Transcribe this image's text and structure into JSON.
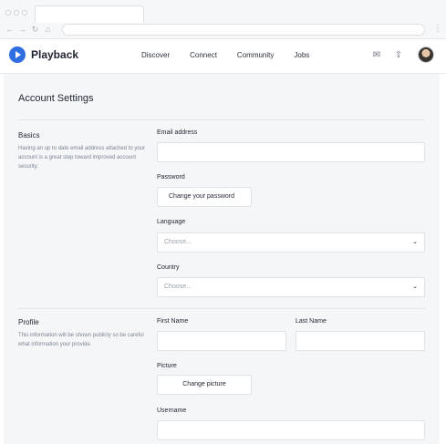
{
  "browser": {
    "nav_icons": {
      "back": "←",
      "forward": "→",
      "reload": "↻",
      "home": "⌂"
    },
    "menu_icon": "⋮"
  },
  "header": {
    "brand": "Playback",
    "nav": [
      "Discover",
      "Connect",
      "Community",
      "Jobs"
    ],
    "icons": {
      "mail": "✉",
      "upload": "⇪"
    }
  },
  "page": {
    "title": "Account Settings",
    "basics": {
      "title": "Basics",
      "description": "Having an up to date email address attached to your account is a great step toward improved account security.",
      "email_label": "Email address",
      "email_value": "",
      "password_label": "Password",
      "password_button": "Change your password",
      "language_label": "Language",
      "language_value": "Choose...",
      "country_label": "Country",
      "country_value": "Choose..."
    },
    "profile": {
      "title": "Profile",
      "description": "This information will be shown publicly so be careful what information your provide.",
      "first_name_label": "First Name",
      "last_name_label": "Last Name",
      "picture_label": "Picture",
      "picture_button": "Change picture",
      "username_label": "Username"
    }
  }
}
